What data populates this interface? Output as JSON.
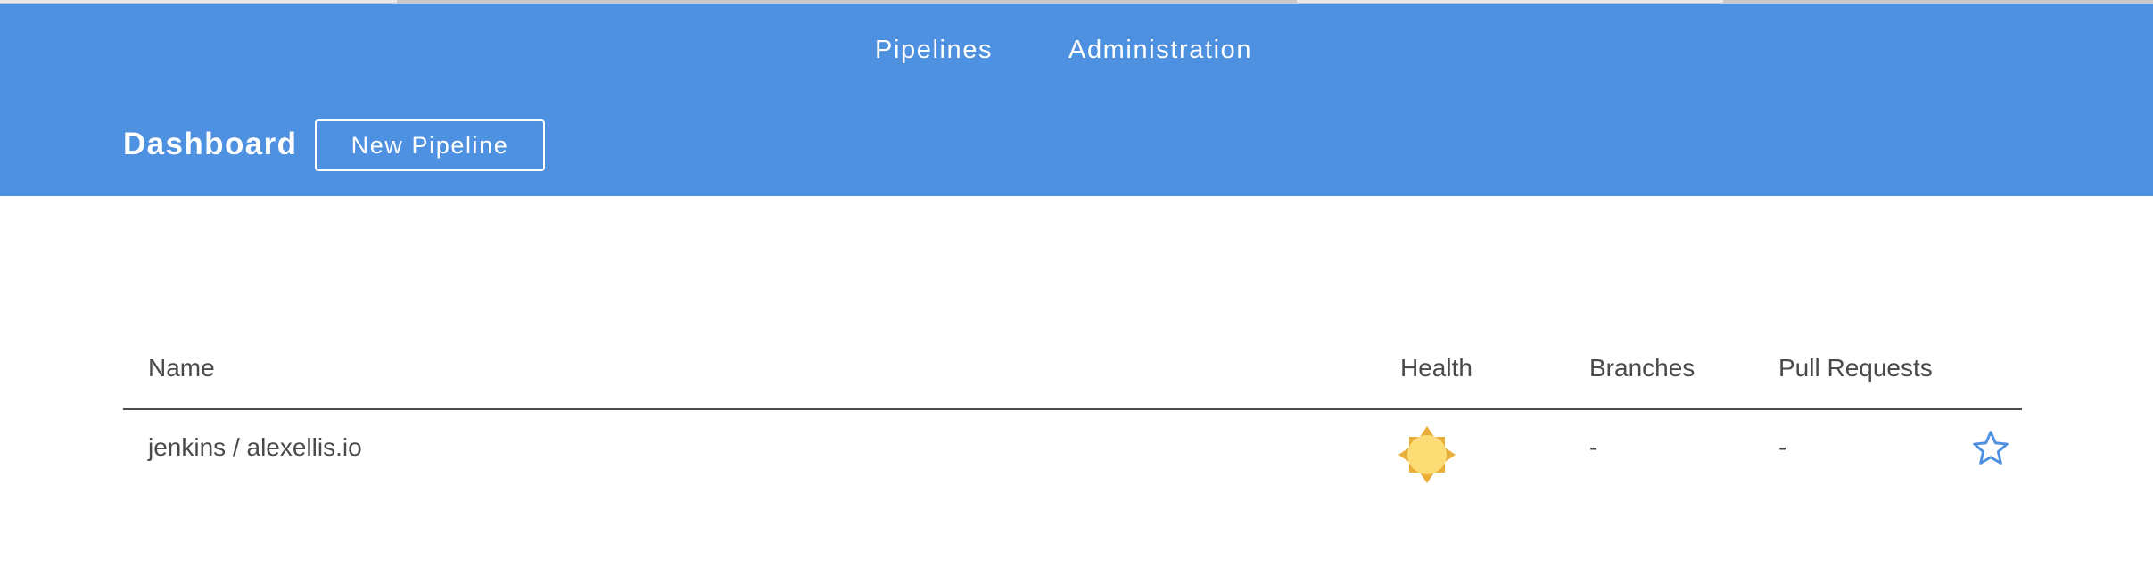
{
  "colors": {
    "header_bg": "#4e91e0",
    "header_text": "#ffffff",
    "body_text": "#4a4a4a",
    "favorite_star": "#4e91e0",
    "health_sun_fill": "#fcdc74",
    "health_sun_rays": "#e8ae37"
  },
  "nav": {
    "items": [
      {
        "label": "Pipelines"
      },
      {
        "label": "Administration"
      }
    ]
  },
  "header": {
    "title": "Dashboard",
    "new_pipeline_label": "New Pipeline"
  },
  "table": {
    "columns": [
      "Name",
      "Health",
      "Branches",
      "Pull Requests"
    ],
    "rows": [
      {
        "name": "jenkins / alexellis.io",
        "health_icon": "sunny-weather-icon",
        "branches": "-",
        "pull_requests": "-",
        "favorite_icon": "star-outline-icon"
      }
    ]
  }
}
